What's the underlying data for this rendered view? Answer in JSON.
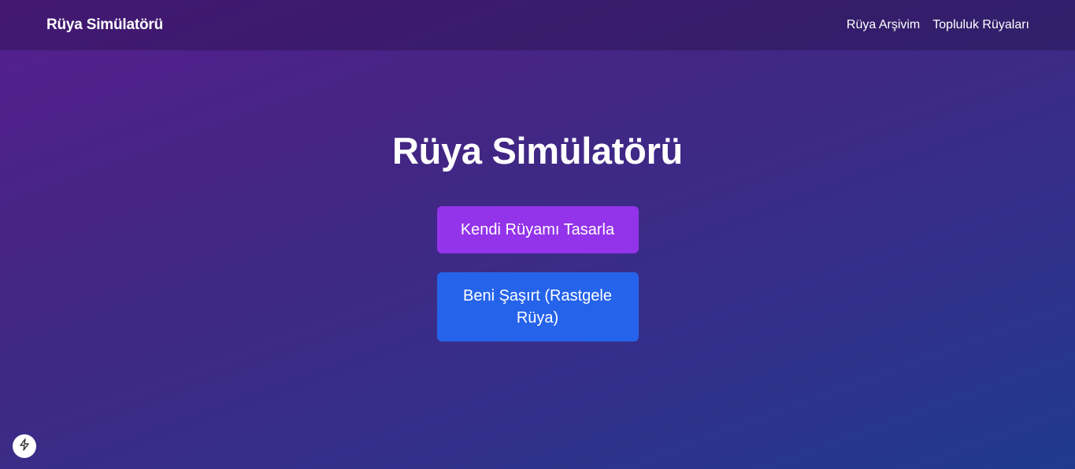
{
  "navbar": {
    "brand": "Rüya Simülatörü",
    "links": [
      "Rüya Arşivim",
      "Topluluk Rüyaları"
    ]
  },
  "hero": {
    "title": "Rüya Simülatörü",
    "design_button": "Kendi Rüyamı Tasarla",
    "random_button": "Beni Şaşırt (Rastgele Rüya)"
  },
  "dev_badge": {
    "icon": "lightning-icon"
  },
  "colors": {
    "design_button": "#9333ea",
    "random_button": "#2563eb",
    "text": "#ffffff"
  }
}
